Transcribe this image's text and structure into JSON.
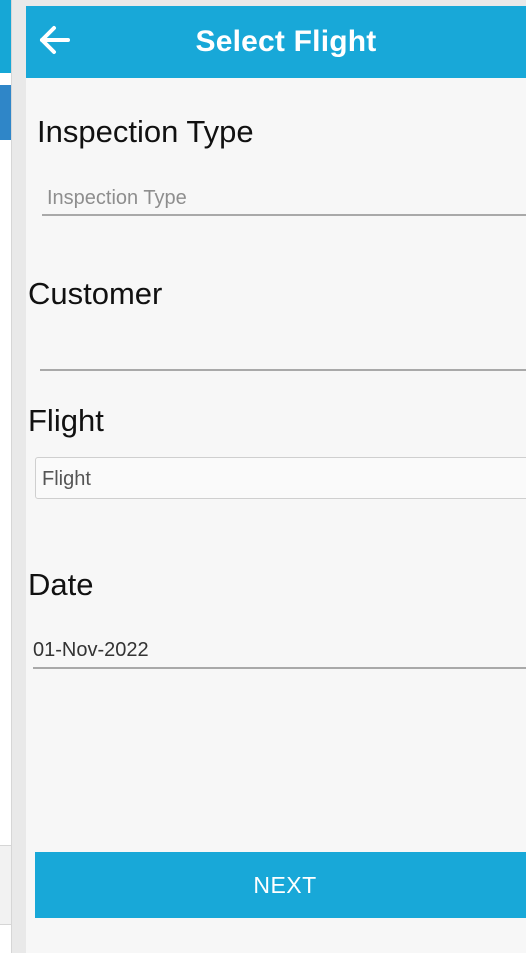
{
  "app_bar": {
    "title": "Select Flight",
    "back_icon": "arrow-left-icon"
  },
  "inspection_type": {
    "label": "Inspection Type",
    "placeholder": "Inspection Type",
    "value": ""
  },
  "customer": {
    "label": "Customer",
    "value": ""
  },
  "flight": {
    "label": "Flight",
    "placeholder": "Flight",
    "value": ""
  },
  "date": {
    "label": "Date",
    "value": "01-Nov-2022"
  },
  "actions": {
    "next_label": "NEXT"
  },
  "colors": {
    "primary": "#18a8d8",
    "background": "#f7f7f7",
    "text": "#111111",
    "placeholder": "#8e8e8e"
  }
}
